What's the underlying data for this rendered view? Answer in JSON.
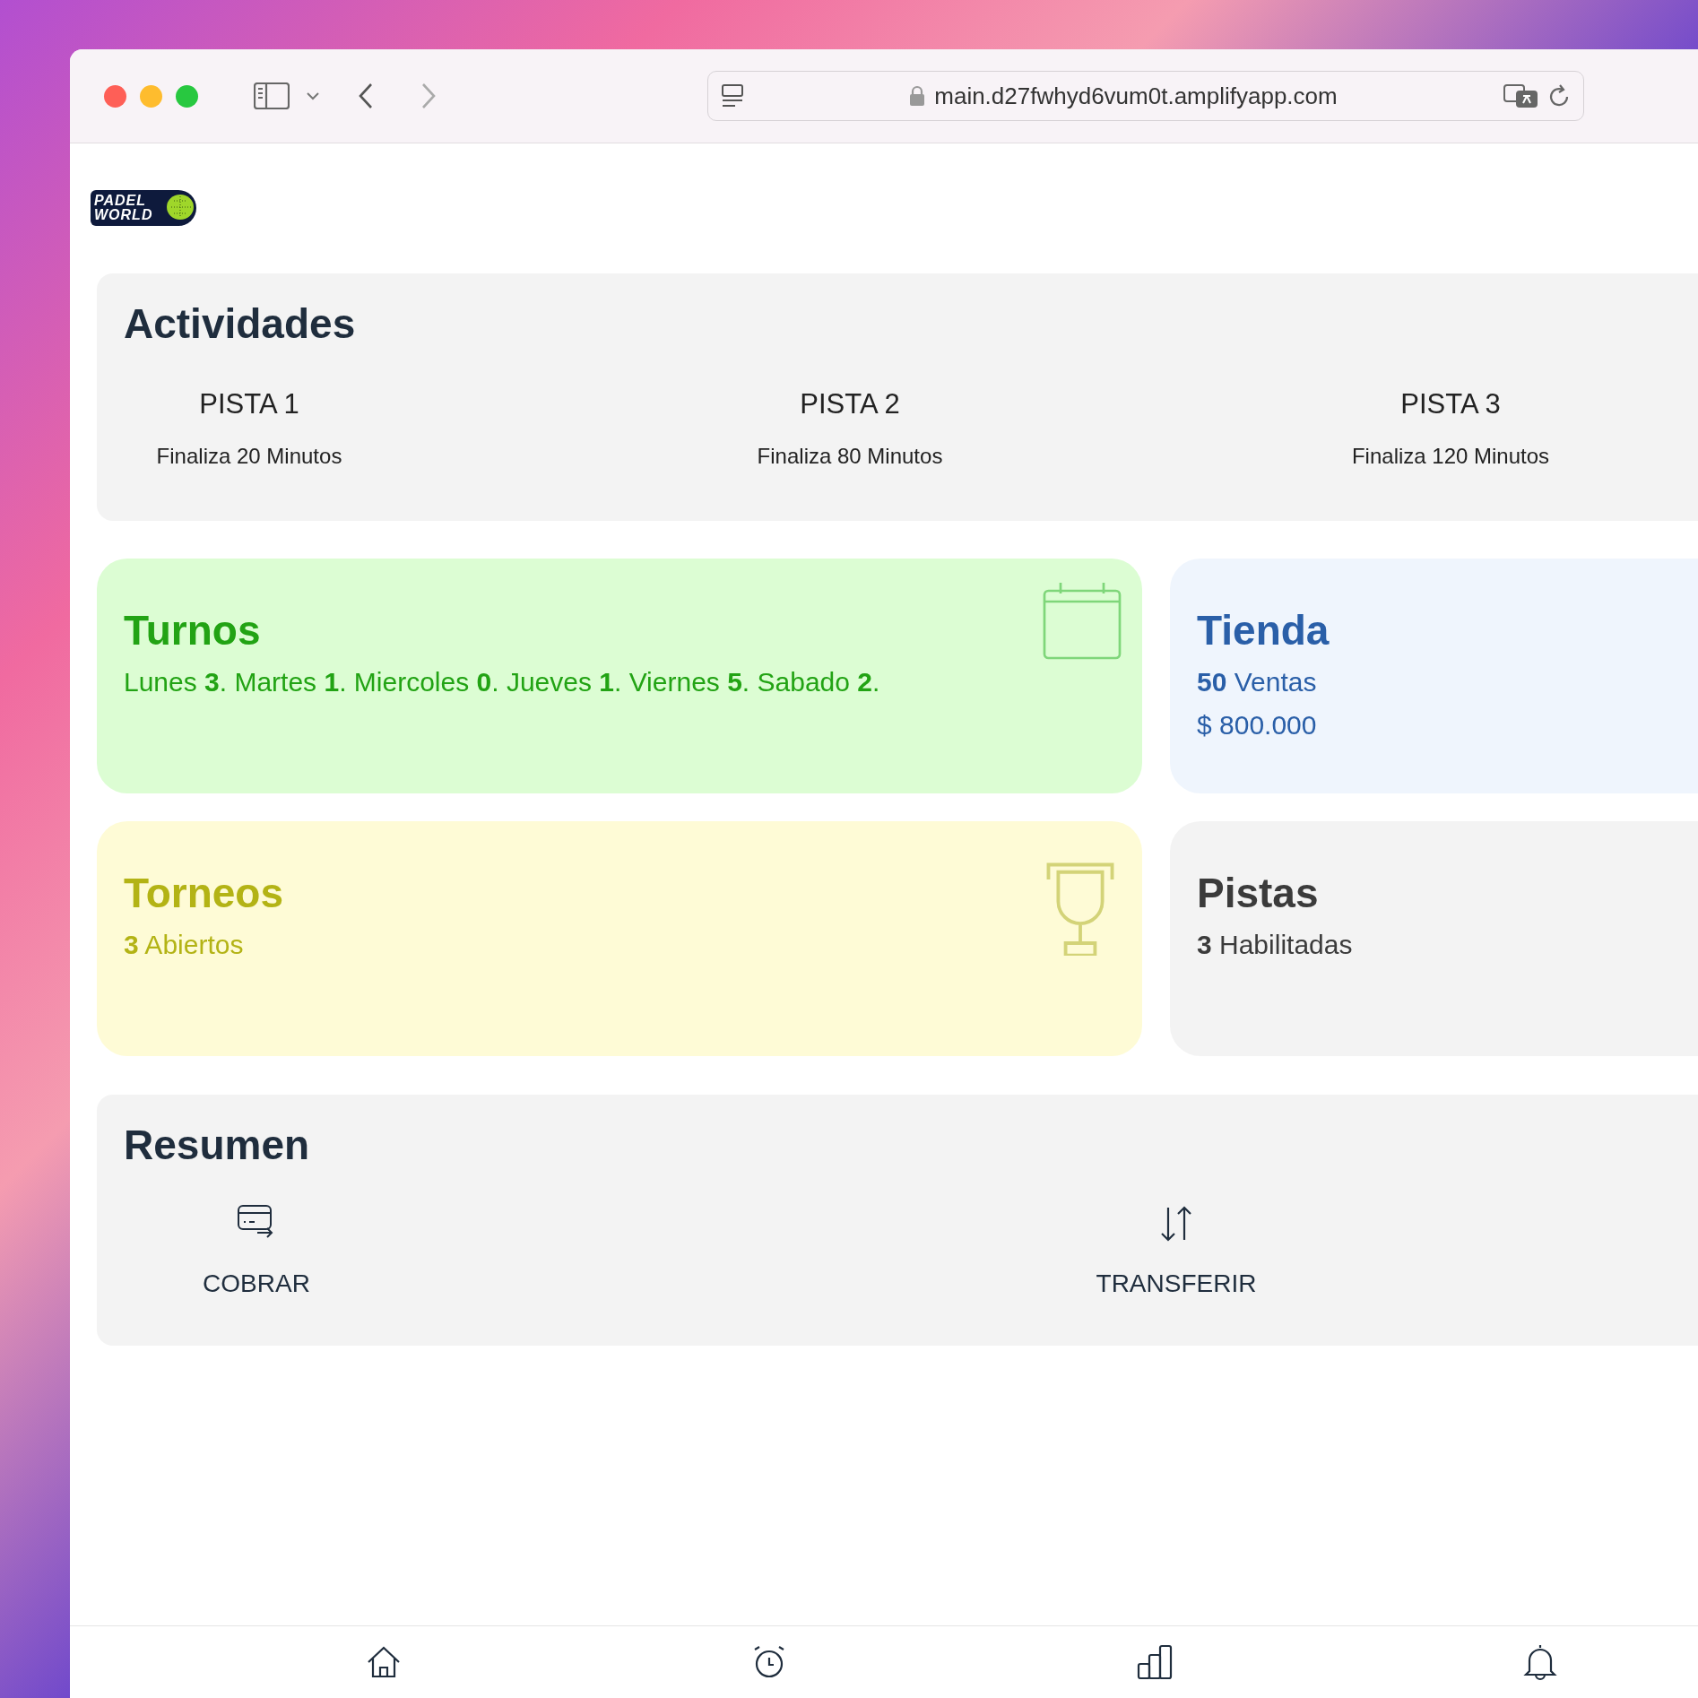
{
  "browser": {
    "url": "main.d27fwhyd6vum0t.amplifyapp.com"
  },
  "logo": {
    "line_1": "PADEL",
    "line_2": "WORLD"
  },
  "actividades": {
    "title": "Actividades",
    "courts": [
      {
        "name": "PISTA 1",
        "status": "Finaliza 20 Minutos"
      },
      {
        "name": "PISTA 2",
        "status": "Finaliza 80 Minutos"
      },
      {
        "name": "PISTA 3",
        "status": "Finaliza 120 Minutos"
      }
    ]
  },
  "cards": [
    {
      "title": "Turnos",
      "color": "#22a314",
      "lines": [
        "Lunes **3**. Martes **1**. Miercoles **0**. Jueves **1**. Viernes **5**. Sabado **2**."
      ]
    },
    {
      "title": "Tienda",
      "color": "#2a5fa8",
      "lines": [
        "**50** Ventas",
        "$ 800.000"
      ]
    },
    {
      "title": "Torneos",
      "color": "#b3b315",
      "lines": [
        "**3** Abiertos"
      ]
    },
    {
      "title": "Pistas",
      "color": "#3b3b3b",
      "lines": [
        "**3** Habilitadas"
      ]
    }
  ],
  "resumen": {
    "title": "Resumen",
    "actions": [
      "COBRAR",
      "TRANSFERIR"
    ]
  }
}
